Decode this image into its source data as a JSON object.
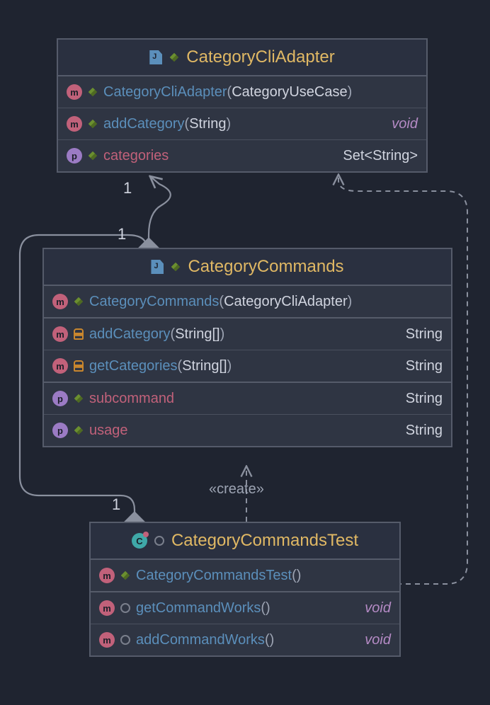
{
  "classes": {
    "adapter": {
      "title": "CategoryCliAdapter",
      "rows": [
        {
          "badge": "m",
          "vis": "pub",
          "name": "CategoryCliAdapter",
          "params": "CategoryUseCase",
          "ret": null,
          "kind": "method"
        },
        {
          "badge": "m",
          "vis": "pub",
          "name": "addCategory",
          "params": "String",
          "ret": "void",
          "kind": "method"
        },
        {
          "badge": "p",
          "vis": "pub",
          "name": "categories",
          "params": null,
          "ret": "Set<String>",
          "kind": "prop"
        }
      ]
    },
    "commands": {
      "title": "CategoryCommands",
      "rows": [
        {
          "badge": "m",
          "vis": "pub",
          "name": "CategoryCommands",
          "params": "CategoryCliAdapter",
          "ret": null,
          "kind": "method",
          "sep": true
        },
        {
          "badge": "m",
          "vis": "prot",
          "name": "addCategory",
          "params": "String[]",
          "ret": "String",
          "kind": "method"
        },
        {
          "badge": "m",
          "vis": "prot",
          "name": "getCategories",
          "params": "String[]",
          "ret": "String",
          "kind": "method",
          "sep": true
        },
        {
          "badge": "p",
          "vis": "pub",
          "name": "subcommand",
          "params": null,
          "ret": "String",
          "kind": "prop"
        },
        {
          "badge": "p",
          "vis": "pub",
          "name": "usage",
          "params": null,
          "ret": "String",
          "kind": "prop"
        }
      ]
    },
    "test": {
      "title": "CategoryCommandsTest",
      "rows": [
        {
          "badge": "m",
          "vis": "pub",
          "name": "CategoryCommandsTest",
          "params": "",
          "ret": null,
          "kind": "method",
          "sep": true
        },
        {
          "badge": "m",
          "vis": "pkg",
          "name": "getCommandWorks",
          "params": "",
          "ret": "void",
          "kind": "method"
        },
        {
          "badge": "m",
          "vis": "pkg",
          "name": "addCommandWorks",
          "params": "",
          "ret": "void",
          "kind": "method"
        }
      ]
    }
  },
  "multiplicities": {
    "m1": "1",
    "m2": "1",
    "m3": "1"
  },
  "labels": {
    "create": "«create»"
  },
  "chart_data": {
    "type": "uml-class-diagram",
    "classes": [
      {
        "name": "CategoryCliAdapter",
        "stereotype": "java-class",
        "members": [
          {
            "kind": "constructor",
            "visibility": "public",
            "signature": "CategoryCliAdapter(CategoryUseCase)"
          },
          {
            "kind": "method",
            "visibility": "public",
            "signature": "addCategory(String)",
            "returns": "void"
          },
          {
            "kind": "property",
            "visibility": "public",
            "name": "categories",
            "type": "Set<String>"
          }
        ]
      },
      {
        "name": "CategoryCommands",
        "stereotype": "java-class",
        "members": [
          {
            "kind": "constructor",
            "visibility": "public",
            "signature": "CategoryCommands(CategoryCliAdapter)"
          },
          {
            "kind": "method",
            "visibility": "protected",
            "signature": "addCategory(String[])",
            "returns": "String"
          },
          {
            "kind": "method",
            "visibility": "protected",
            "signature": "getCategories(String[])",
            "returns": "String"
          },
          {
            "kind": "property",
            "visibility": "public",
            "name": "subcommand",
            "type": "String"
          },
          {
            "kind": "property",
            "visibility": "public",
            "name": "usage",
            "type": "String"
          }
        ]
      },
      {
        "name": "CategoryCommandsTest",
        "stereotype": "test-class",
        "members": [
          {
            "kind": "constructor",
            "visibility": "public",
            "signature": "CategoryCommandsTest()"
          },
          {
            "kind": "method",
            "visibility": "package",
            "signature": "getCommandWorks()",
            "returns": "void"
          },
          {
            "kind": "method",
            "visibility": "package",
            "signature": "addCommandWorks()",
            "returns": "void"
          }
        ]
      }
    ],
    "relationships": [
      {
        "from": "CategoryCommands",
        "to": "CategoryCliAdapter",
        "type": "composition",
        "from_mult": "1",
        "to_mult": "1"
      },
      {
        "from": "CategoryCommandsTest",
        "to": "CategoryCommands",
        "type": "composition",
        "from_mult": "1"
      },
      {
        "from": "CategoryCommandsTest",
        "to": "CategoryCommands",
        "type": "dependency",
        "label": "«create»"
      },
      {
        "from": "CategoryCommandsTest",
        "to": "CategoryCliAdapter",
        "type": "dependency"
      }
    ]
  }
}
